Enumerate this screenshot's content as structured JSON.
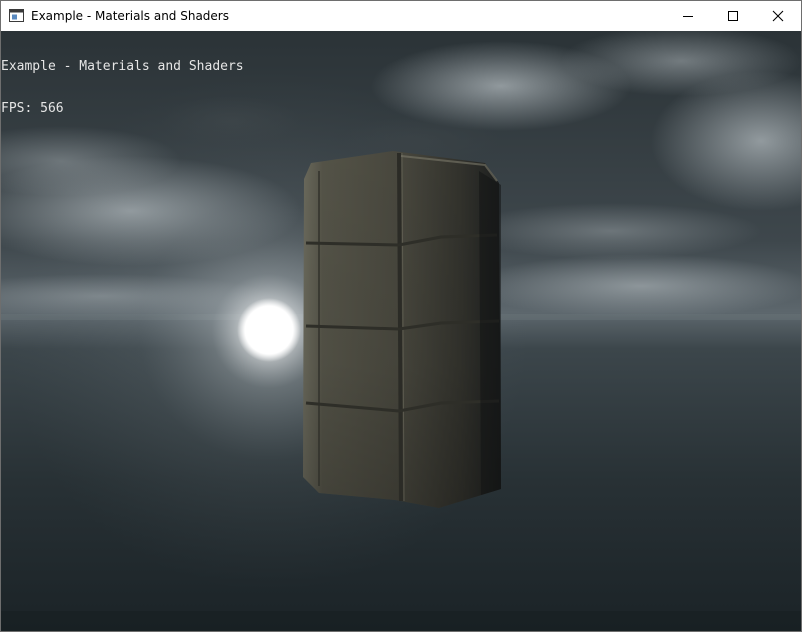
{
  "window": {
    "title": "Example - Materials and Shaders",
    "icon": "application-window-icon",
    "controls": {
      "minimize": "minimize-icon",
      "maximize": "maximize-icon",
      "close": "close-icon"
    }
  },
  "hud": {
    "title": "Example - Materials and Shaders",
    "fps_label": "FPS: 566"
  },
  "scene": {
    "sky_top_color": "#2a3236",
    "horizon_color": "#596369",
    "ground_color": "#1d2529",
    "sun_color": "#ffffff",
    "object": "stone-brick-pillar"
  }
}
